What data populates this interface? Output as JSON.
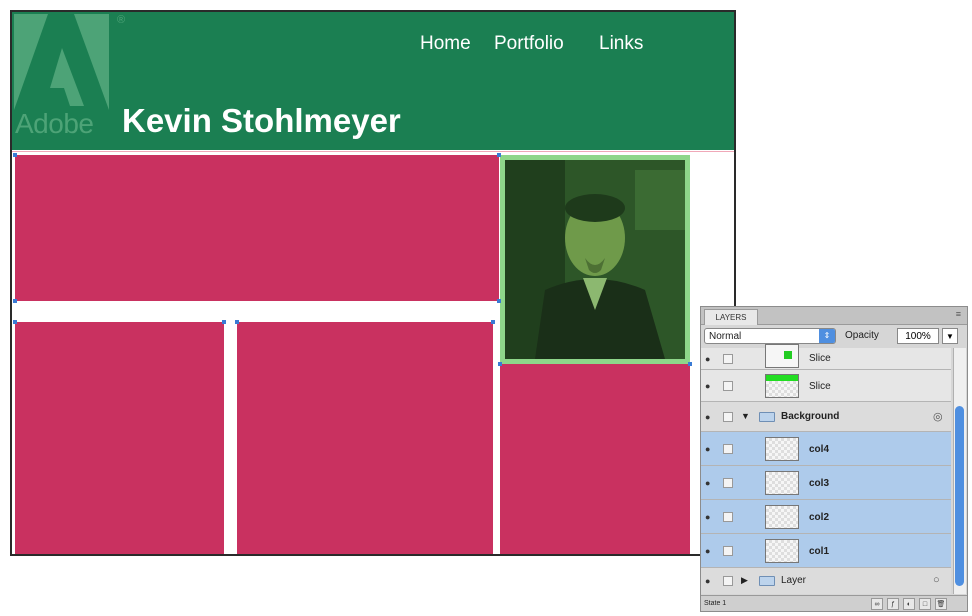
{
  "site": {
    "logo_text": "Adobe",
    "registered_mark": "®",
    "name": "Kevin Stohlmeyer",
    "nav": {
      "home": "Home",
      "portfolio": "Portfolio",
      "links": "Links"
    }
  },
  "colors": {
    "header_green": "#1b7f52",
    "content_pink": "#c93160",
    "photo_frame": "#8ed68a",
    "selection_blue": "#aecbeb"
  },
  "layers_panel": {
    "tab": "LAYERS",
    "menu_icon": "panel-menu-icon",
    "blend_mode": "Normal",
    "opacity_label": "Opacity",
    "opacity_value": "100%",
    "layers": [
      {
        "name": "Slice",
        "type": "slice",
        "selected": false
      },
      {
        "name": "Slice",
        "type": "slice",
        "selected": false
      },
      {
        "name": "Background",
        "type": "group",
        "expanded": true,
        "selected": false
      },
      {
        "name": "col4",
        "type": "layer",
        "selected": true
      },
      {
        "name": "col3",
        "type": "layer",
        "selected": true
      },
      {
        "name": "col2",
        "type": "layer",
        "selected": true
      },
      {
        "name": "col1",
        "type": "layer",
        "selected": true
      },
      {
        "name": "Layer",
        "type": "group",
        "expanded": false,
        "selected": false
      }
    ],
    "footer_state": "State 1"
  }
}
